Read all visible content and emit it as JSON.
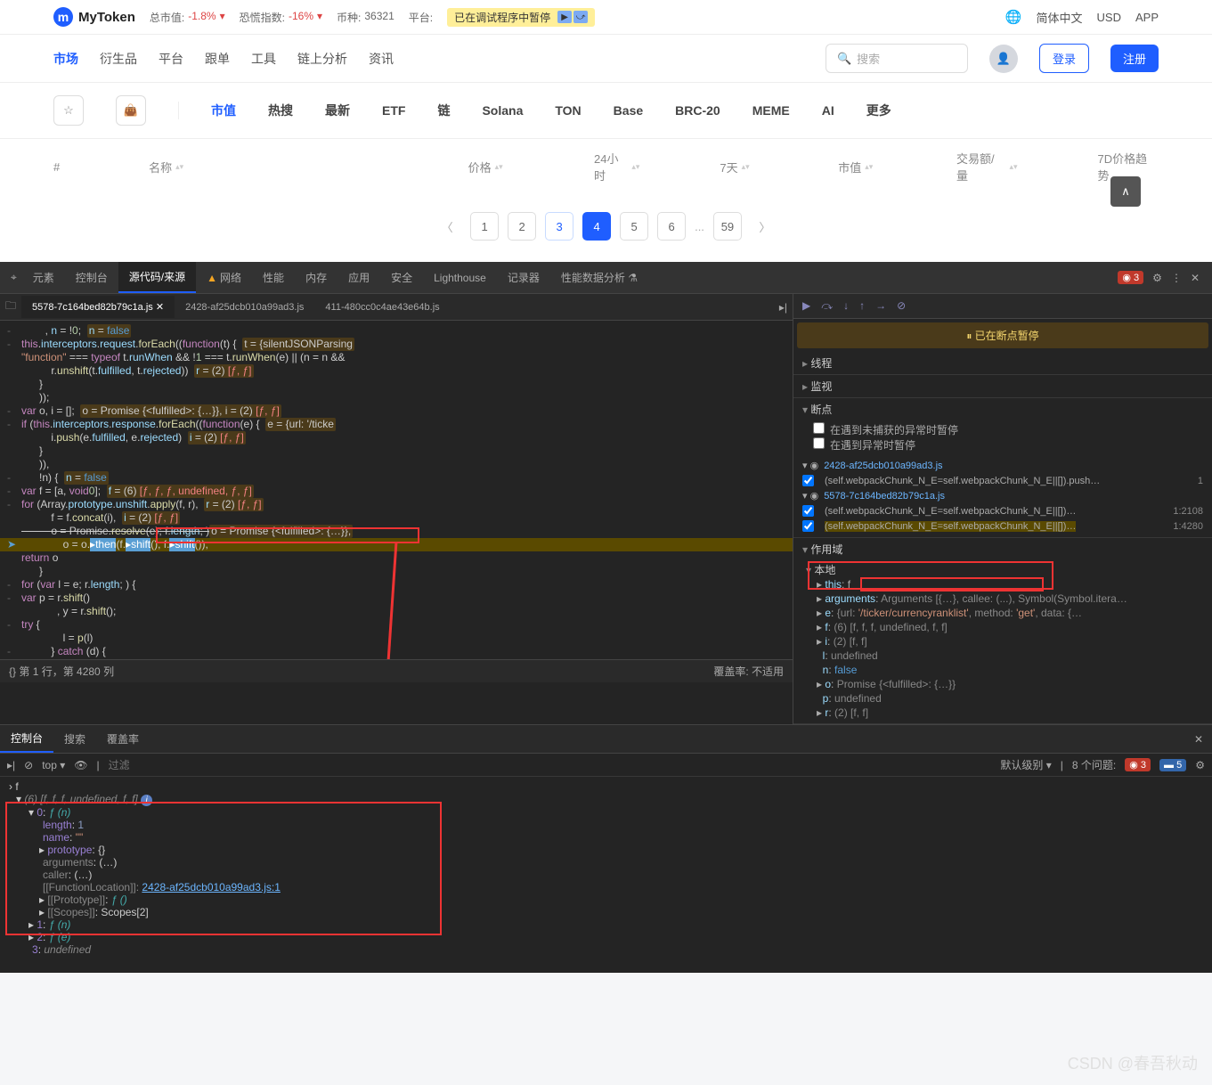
{
  "topbar": {
    "brand": "MyToken",
    "stats": [
      {
        "label": "总市值:",
        "value": "-1.8%",
        "suffix": "▾"
      },
      {
        "label": "恐慌指数:",
        "value": "-16%",
        "suffix": "▾"
      },
      {
        "label": "币种:",
        "value": "36321"
      },
      {
        "label": "平台:",
        "value": ""
      }
    ],
    "paused": "已在调试程序中暂停",
    "right": [
      "简体中文",
      "USD",
      "APP"
    ]
  },
  "mainnav": {
    "items": [
      "市场",
      "衍生品",
      "平台",
      "跟单",
      "工具",
      "链上分析",
      "资讯"
    ],
    "active": 0,
    "search_placeholder": "搜索",
    "login": "登录",
    "register": "注册"
  },
  "subnav": {
    "items": [
      "市值",
      "热搜",
      "最新",
      "ETF",
      "链",
      "Solana",
      "TON",
      "Base",
      "BRC-20",
      "MEME",
      "AI",
      "更多"
    ],
    "active": 0
  },
  "table": {
    "cols": [
      "#",
      "名称",
      "价格",
      "24小时",
      "7天",
      "市值",
      "交易额/量",
      "7D价格趋势"
    ]
  },
  "pagination": {
    "pages": [
      "1",
      "2",
      "3",
      "4",
      "5",
      "6",
      "...",
      "59"
    ],
    "active": 3,
    "link": 2
  },
  "devtools": {
    "tabs": [
      "元素",
      "控制台",
      "源代码/来源",
      "网络",
      "性能",
      "内存",
      "应用",
      "安全",
      "Lighthouse",
      "记录器",
      "性能数据分析"
    ],
    "active": 2,
    "warn_tab": 3,
    "errors": 3,
    "file_tabs": [
      "5578-7c164bed82b79c1a.js",
      "2428-af25dcb010a99ad3.js",
      "411-480cc0c4ae43e64b.js"
    ],
    "active_file": 0,
    "status_left": "第 1 行，第 4280 列",
    "status_right": "覆盖率: 不适用",
    "code_hover_url": "'/ticker/currencyranklist'",
    "paused_msg": "已在断点暂停",
    "sections": {
      "threads": "线程",
      "watch": "监视",
      "breakpoints": "断点",
      "bp_uncaught": "在遇到未捕获的异常时暂停",
      "bp_caught": "在遇到异常时暂停",
      "bp_files": [
        {
          "file": "2428-af25dcb010a99ad3.js",
          "text": "(self.webpackChunk_N_E=self.webpackChunk_N_E||[]).push…",
          "loc": "1"
        },
        {
          "file": "5578-7c164bed82b79c1a.js",
          "text": "(self.webpackChunk_N_E=self.webpackChunk_N_E||[])…",
          "loc": "1:2108"
        },
        {
          "file_hidden": true,
          "text": "(self.webpackChunk_N_E=self.webpackChunk_N_E||[])…",
          "loc": "1:4280"
        }
      ],
      "scope": "作用域",
      "local": "本地",
      "scope_items": [
        {
          "k": "this",
          "v": "f"
        },
        {
          "k": "arguments",
          "v": "Arguments [{…}, callee: (...), Symbol(Symbol.itera…"
        },
        {
          "k": "e",
          "v": "{url: '/ticker/currencyranklist', method: 'get', data: {…"
        },
        {
          "k": "f",
          "v": "(6) [f, f, f, undefined, f, f]"
        },
        {
          "k": "i",
          "v": "(2) [f, f]"
        },
        {
          "k": "l",
          "v": "undefined"
        },
        {
          "k": "n",
          "v": "false"
        },
        {
          "k": "o",
          "v": "Promise {<fulfilled>: {…}}"
        },
        {
          "k": "p",
          "v": "undefined"
        },
        {
          "k": "r",
          "v": "(2) [f, f]"
        }
      ]
    }
  },
  "console": {
    "tabs": [
      "控制台",
      "搜索",
      "覆盖率"
    ],
    "active": 0,
    "context": "top",
    "filter_placeholder": "过滤",
    "level": "默认级别",
    "issues_label": "8 个问题:",
    "err": 3,
    "info": 5,
    "input": "f",
    "output": {
      "header": "(6) [f, f, f, undefined, f, f]",
      "item0": "0: f (n)",
      "length": "length: 1",
      "name": "name: \"\"",
      "proto": "prototype: {}",
      "args": "arguments:  (…)",
      "caller": "caller:  (…)",
      "funcloc_label": "[[FunctionLocation]]:",
      "funcloc_link": "2428-af25dcb010a99ad3.js:1",
      "proto2": "[[Prototype]]: f ()",
      "scopes": "[[Scopes]]: Scopes[2]",
      "item1": "1: f (n)",
      "item2": "2: f (e)",
      "item3": "3: undefined"
    }
  },
  "watermark": "CSDN @春吾秋动"
}
